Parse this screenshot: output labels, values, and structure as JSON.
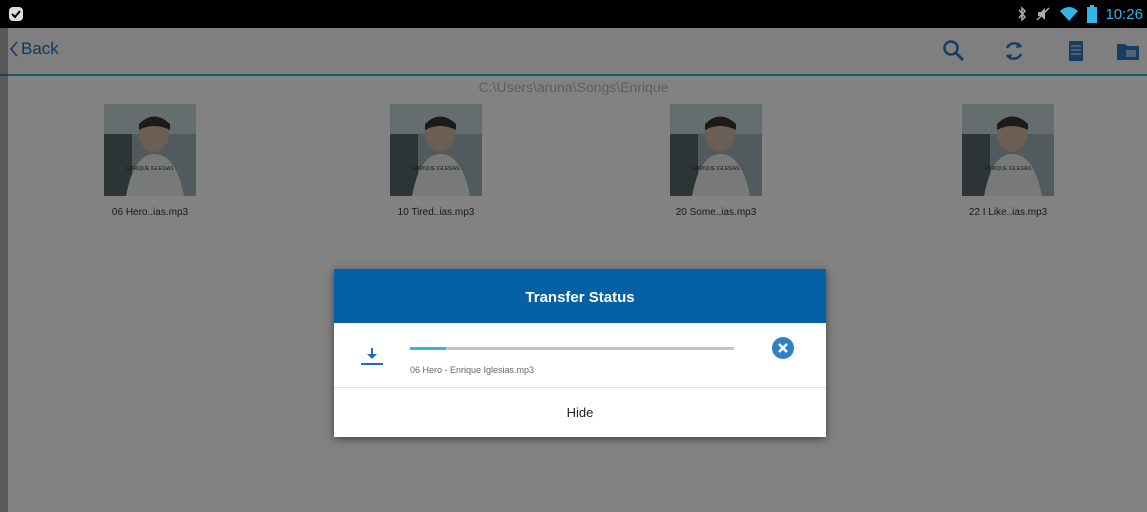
{
  "status_bar": {
    "time": "10:26",
    "icons": [
      "notification-check-icon",
      "bluetooth-icon",
      "mute-icon",
      "wifi-icon",
      "battery-icon"
    ]
  },
  "action_bar": {
    "back_label": "Back",
    "actions": [
      "search-icon",
      "refresh-icon",
      "list-view-icon",
      "folder-icon"
    ]
  },
  "path": "C:\\Users\\aruna\\Songs\\Enrique",
  "files": [
    {
      "name": "06 Hero..ias.mp3",
      "art_text": "ENRIQUE IGLESIAS"
    },
    {
      "name": "10 Tired..ias.mp3",
      "art_text": "ENRIQUE IGLESIAS"
    },
    {
      "name": "20 Some..ias.mp3",
      "art_text": "ENRIQUE IGLESIAS"
    },
    {
      "name": "22  I Like..ias.mp3",
      "art_text": "ENRIQUE IGLESIAS"
    }
  ],
  "dialog": {
    "title": "Transfer Status",
    "transfer": {
      "file_name": "06 Hero - Enrique Iglesias.mp3",
      "progress": 0.11
    },
    "hide_label": "Hide"
  },
  "colors": {
    "accent": "#33b5e5",
    "dialog_header": "#0561a6",
    "back_text": "#1e6fb8"
  }
}
